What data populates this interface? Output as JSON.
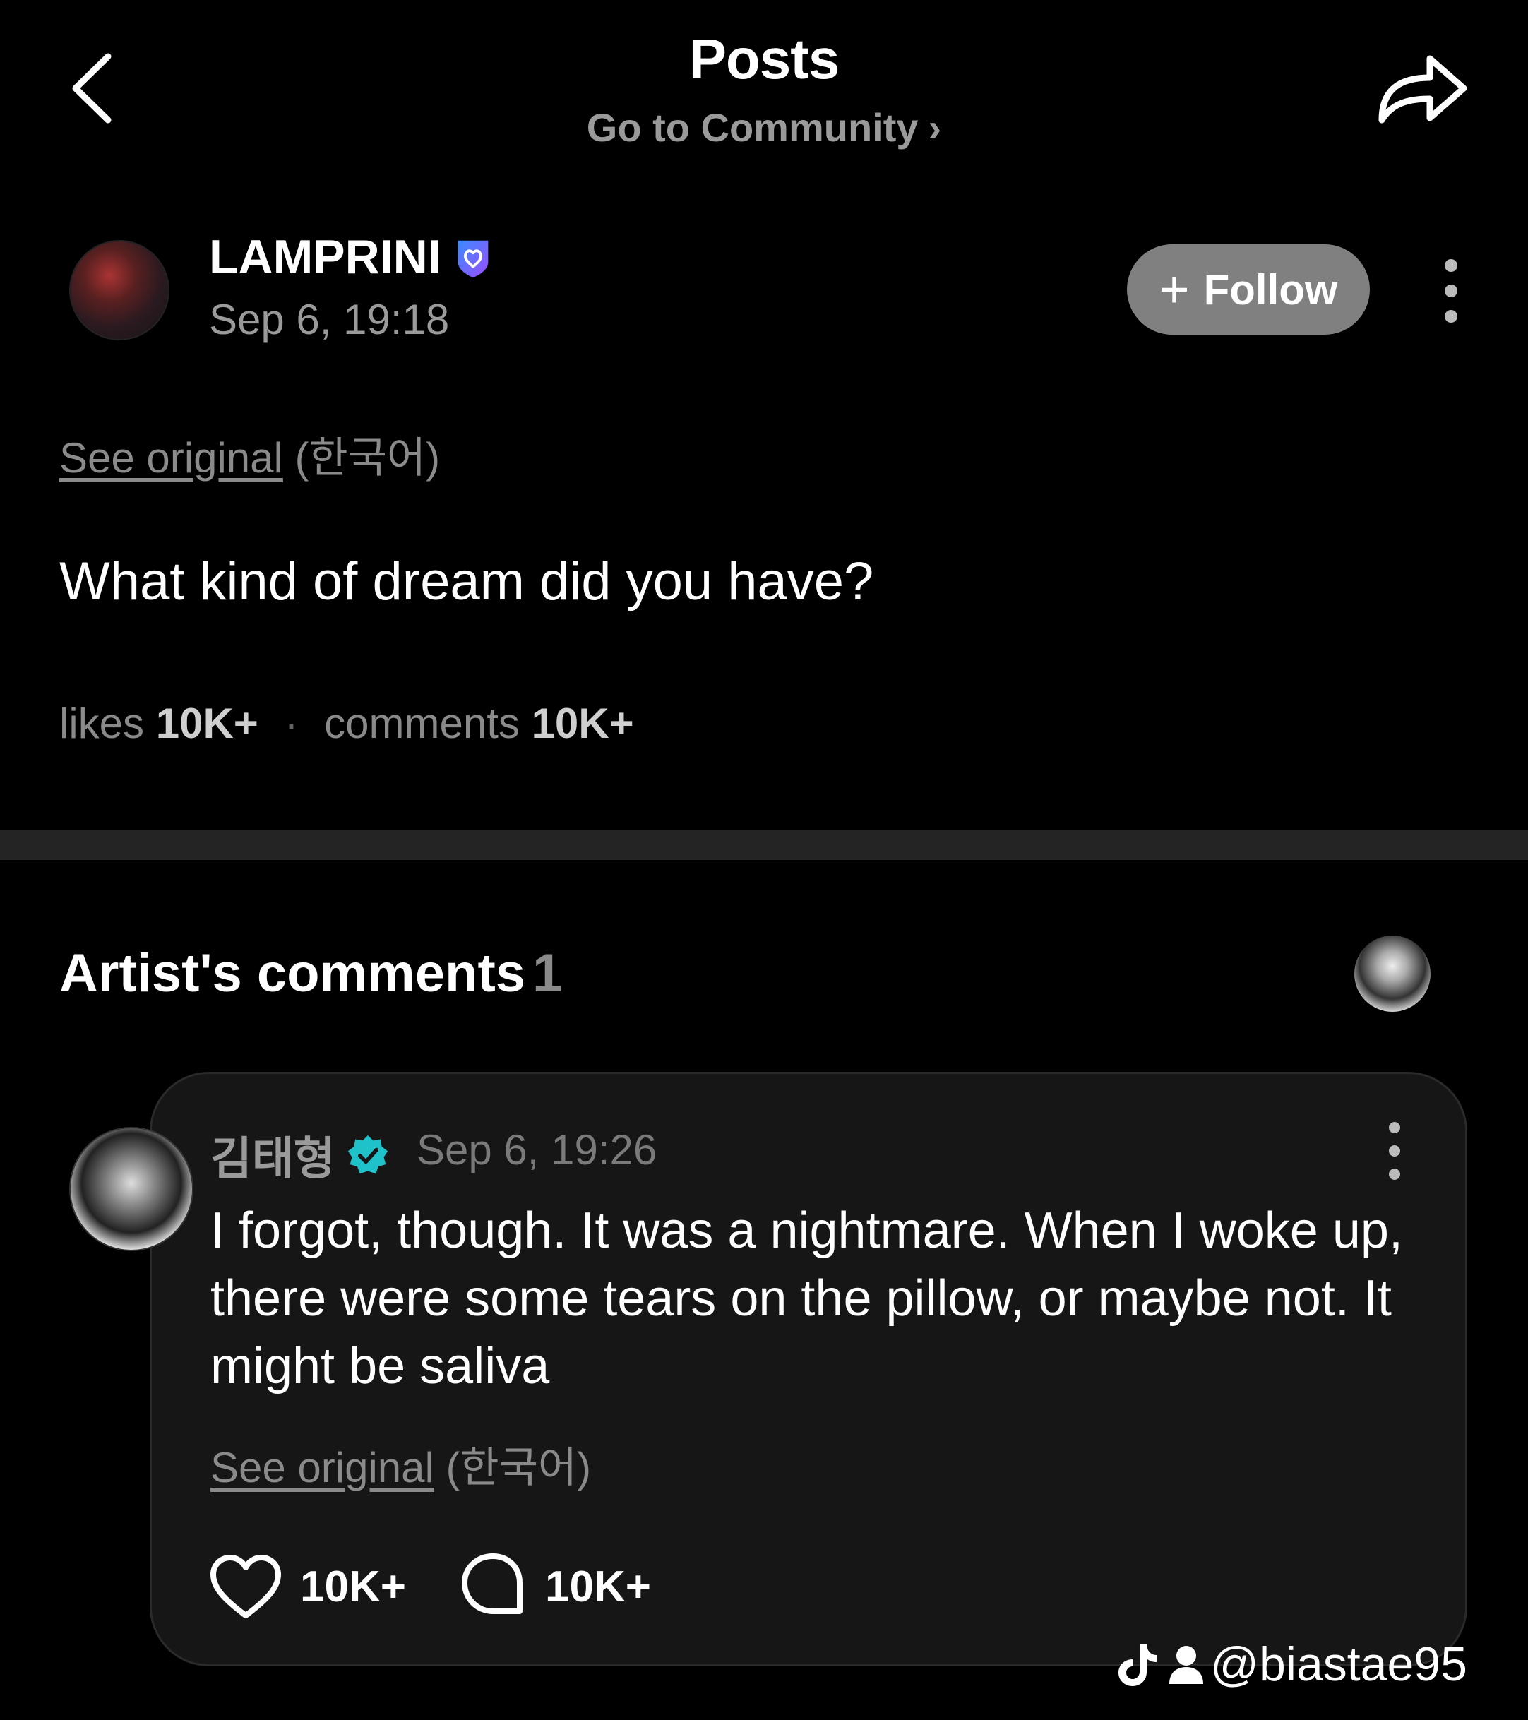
{
  "header": {
    "title": "Posts",
    "subtitle": "Go to Community",
    "back_icon": "chevron-left-icon",
    "share_icon": "share-arrow-icon"
  },
  "post": {
    "author": "LAMPRINI",
    "date": "Sep 6, 19:18",
    "follow_label": "Follow",
    "see_original_link": "See original",
    "see_original_lang": "(한국어)",
    "body": "What kind of dream did you have?",
    "likes_label": "likes",
    "likes_value": "10K+",
    "comments_label": "comments",
    "comments_value": "10K+"
  },
  "artist_comments": {
    "heading": "Artist's comments",
    "count": "1",
    "comment": {
      "author": "김태형",
      "date": "Sep 6, 19:26",
      "body": "I forgot, though. It was a nightmare. When I woke up, there were some tears on the pillow, or maybe not. It might be saliva",
      "see_original_link": "See original",
      "see_original_lang": "(한국어)",
      "likes": "10K+",
      "replies": "10K+"
    }
  },
  "watermark": {
    "handle": "@biastae95"
  },
  "colors": {
    "background": "#000000",
    "card": "#161616",
    "muted": "#8a8a8a",
    "follow_button": "#808080",
    "verified_purple": "#6a5cff",
    "verified_teal": "#1fc2c9"
  }
}
